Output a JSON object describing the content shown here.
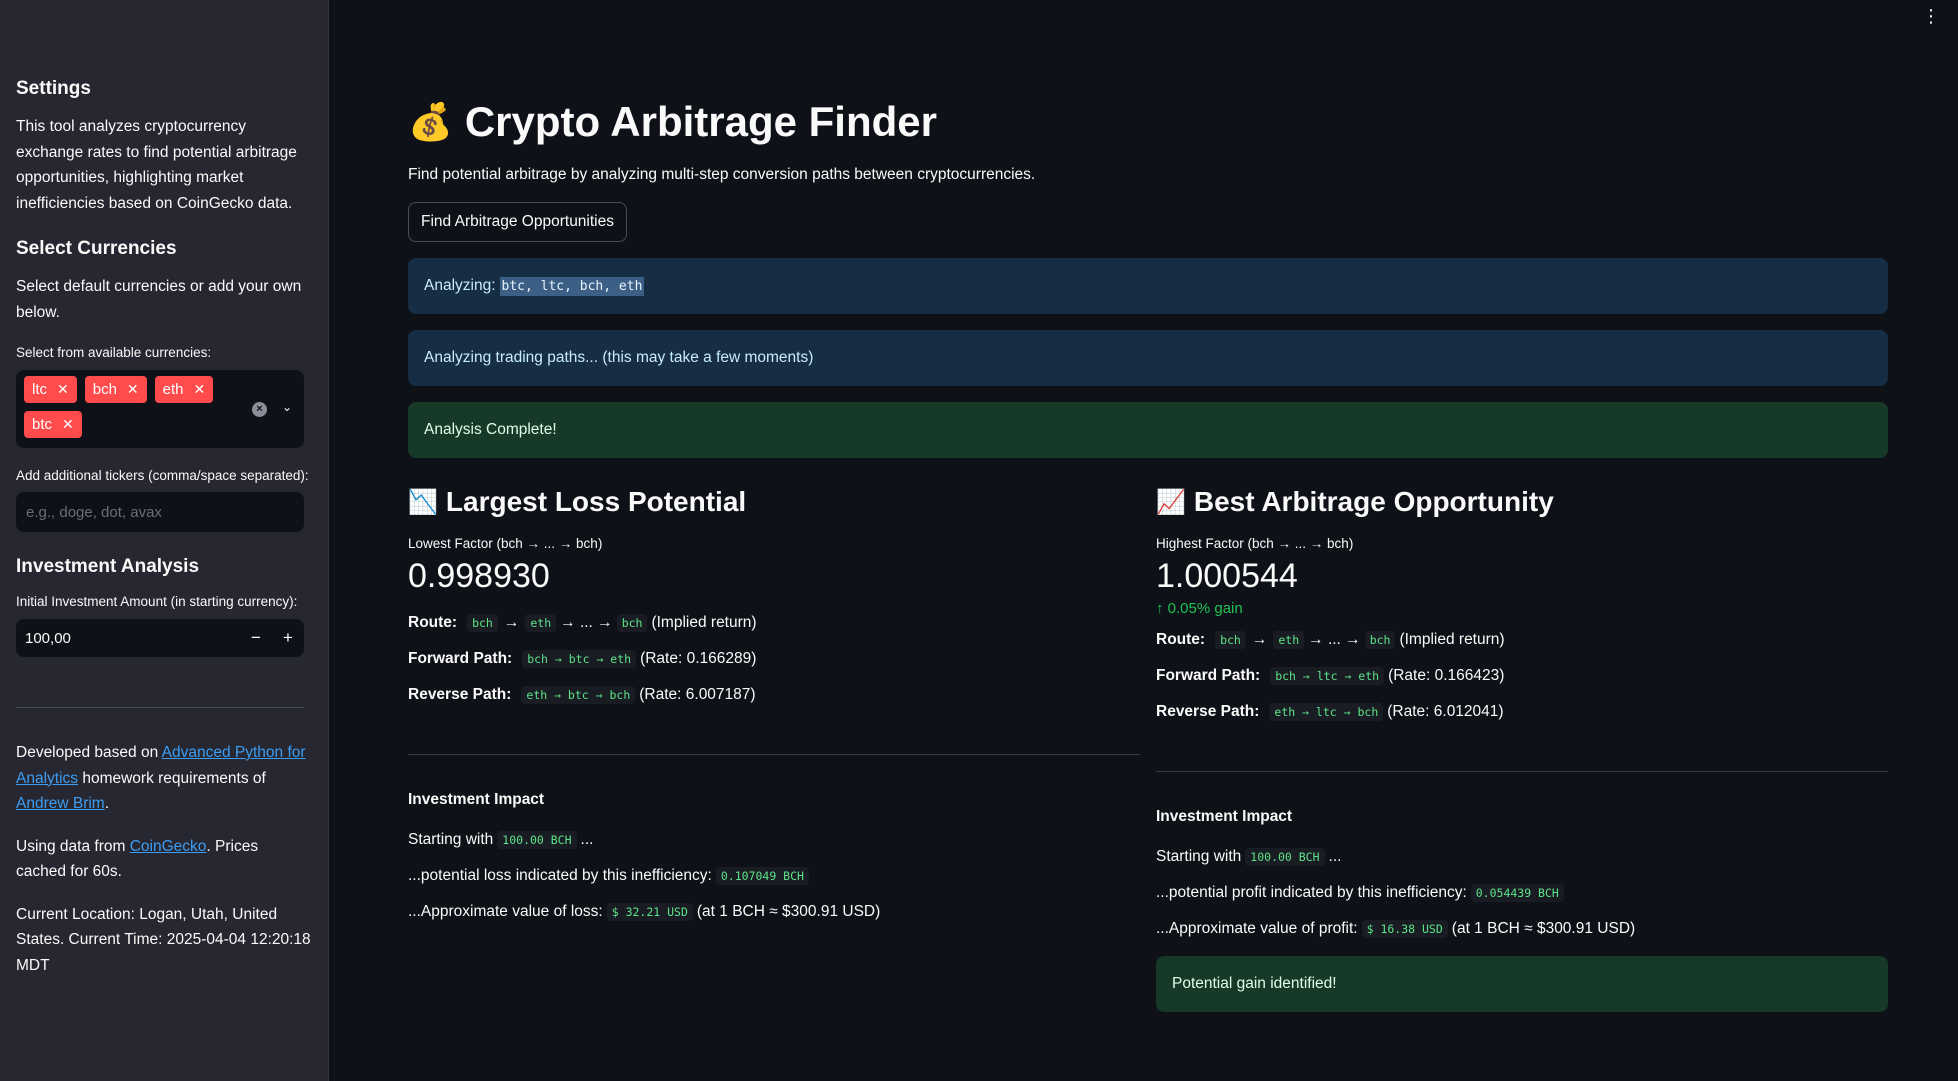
{
  "sidebar": {
    "settings_title": "Settings",
    "description": "This tool analyzes cryptocurrency exchange rates to find potential arbitrage opportunities, highlighting market inefficiencies based on CoinGecko data.",
    "select_title": "Select Currencies",
    "select_help": "Select default currencies or add your own below.",
    "select_label": "Select from available currencies:",
    "selected": [
      "ltc",
      "bch",
      "eth",
      "btc"
    ],
    "tickers_label": "Add additional tickers (comma/space separated):",
    "tickers_placeholder": "e.g., doge, dot, avax",
    "investment_title": "Investment Analysis",
    "investment_label": "Initial Investment Amount (in starting currency):",
    "investment_value": "100,00",
    "minus": "−",
    "plus": "+",
    "dev_prefix": "Developed based on ",
    "dev_link": "Advanced Python for Analytics",
    "dev_middle": " homework requirements of ",
    "dev_author": "Andrew Brim",
    "dev_end": ".",
    "data_prefix": "Using data from ",
    "data_link": "CoinGecko",
    "data_suffix": ". Prices cached for 60s.",
    "location": "Current Location: Logan, Utah, United States. Current Time: 2025-04-04 12:20:18 MDT"
  },
  "main": {
    "title_emoji": "💰",
    "title": "Crypto Arbitrage Finder",
    "subtitle": "Find potential arbitrage by analyzing multi-step conversion paths between cryptocurrencies.",
    "button": "Find Arbitrage Opportunities",
    "alert1_prefix": "Analyzing:",
    "alert1_code": "btc, ltc, bch, eth",
    "alert2": "Analyzing trading paths... (this may take a few moments)",
    "alert3": "Analysis Complete!"
  },
  "loss": {
    "emoji": "📉",
    "title": "Largest Loss Potential",
    "metric_label": "Lowest Factor (bch → ... → bch)",
    "metric_value": "0.998930",
    "route_label": "Route:",
    "route_a": "bch",
    "route_b": "eth",
    "route_dots": "→ ... →",
    "route_c": "bch",
    "route_note": "(Implied return)",
    "fwd_label": "Forward Path:",
    "fwd_code": "bch → btc → eth",
    "fwd_rate": "(Rate: 0.166289)",
    "rev_label": "Reverse Path:",
    "rev_code": "eth → btc → bch",
    "rev_rate": "(Rate: 6.007187)",
    "impact_title": "Investment Impact",
    "start_prefix": "Starting with",
    "start_code": "100.00 BCH",
    "start_suffix": "...",
    "pot_prefix": "...potential loss indicated by this inefficiency:",
    "pot_code": "0.107049 BCH",
    "val_prefix": "...Approximate value of loss:",
    "val_code": "$ 32.21 USD",
    "val_suffix": "(at 1 BCH ≈ $300.91 USD)"
  },
  "gain": {
    "emoji": "📈",
    "title": "Best Arbitrage Opportunity",
    "metric_label": "Highest Factor (bch → ... → bch)",
    "metric_value": "1.000544",
    "delta": "↑ 0.05% gain",
    "route_label": "Route:",
    "route_a": "bch",
    "route_b": "eth",
    "route_dots": "→ ... →",
    "route_c": "bch",
    "route_note": "(Implied return)",
    "fwd_label": "Forward Path:",
    "fwd_code": "bch → ltc → eth",
    "fwd_rate": "(Rate: 0.166423)",
    "rev_label": "Reverse Path:",
    "rev_code": "eth → ltc → bch",
    "rev_rate": "(Rate: 6.012041)",
    "impact_title": "Investment Impact",
    "start_prefix": "Starting with",
    "start_code": "100.00 BCH",
    "start_suffix": "...",
    "pot_prefix": "...potential profit indicated by this inefficiency:",
    "pot_code": "0.054439 BCH",
    "val_prefix": "...Approximate value of profit:",
    "val_code": "$ 16.38 USD",
    "val_suffix": "(at 1 BCH ≈ $300.91 USD)",
    "success": "Potential gain identified!"
  },
  "colors": {
    "accent": "#ff4b4b",
    "info_bg": "#172d43",
    "success_bg": "#173928",
    "positive": "#21c354"
  },
  "icons": {
    "menu": "kebab-menu-icon"
  }
}
